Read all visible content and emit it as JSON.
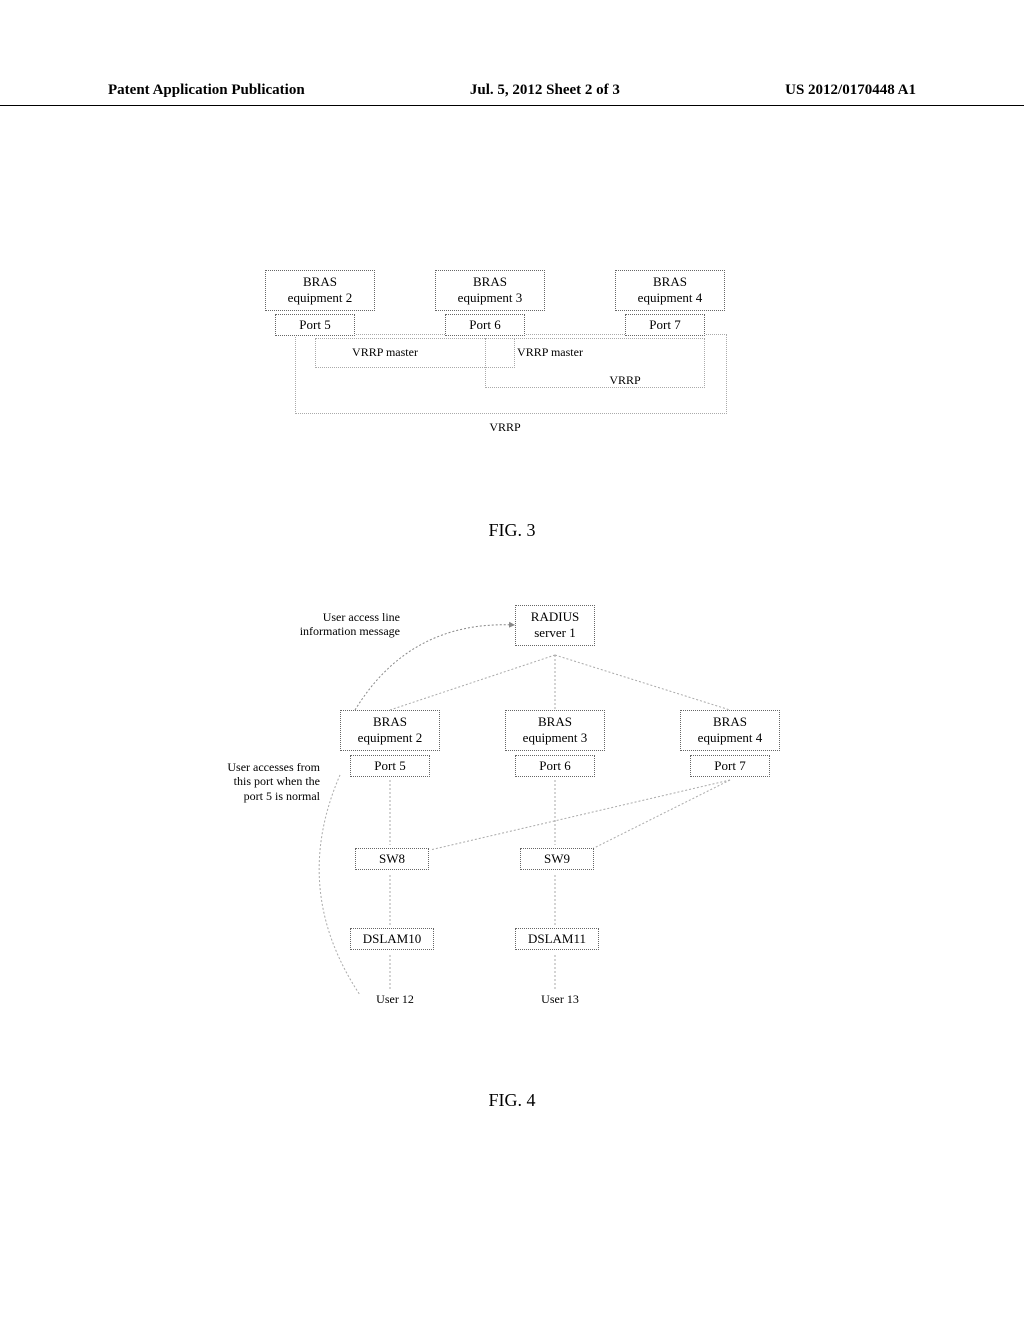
{
  "header": {
    "left": "Patent Application Publication",
    "center": "Jul. 5, 2012   Sheet 2 of 3",
    "right": "US 2012/0170448 A1"
  },
  "fig3": {
    "bras2": "BRAS\nequipment 2",
    "bras3": "BRAS\nequipment 3",
    "bras4": "BRAS\nequipment 4",
    "port5": "Port 5",
    "port6": "Port 6",
    "port7": "Port 7",
    "vrrp_master1": "VRRP master",
    "vrrp_master2": "VRRP master",
    "vrrp_inner": "VRRP",
    "vrrp_outer": "VRRP",
    "caption": "FIG. 3"
  },
  "fig4": {
    "user_access_msg": "User access line\ninformation message",
    "radius": "RADIUS\nserver 1",
    "bras2": "BRAS\nequipment 2",
    "bras3": "BRAS\nequipment 3",
    "bras4": "BRAS\nequipment 4",
    "port5": "Port 5",
    "port6": "Port 6",
    "port7": "Port 7",
    "user_from_port_note": "User accesses from\nthis port when the\nport 5 is normal",
    "sw8": "SW8",
    "sw9": "SW9",
    "dslam10": "DSLAM10",
    "dslam11": "DSLAM11",
    "user12": "User 12",
    "user13": "User 13",
    "caption": "FIG. 4"
  }
}
